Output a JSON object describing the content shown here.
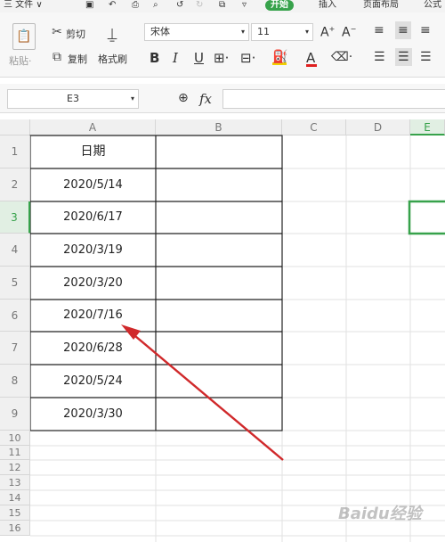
{
  "menubar": {
    "file_label": "三 文件 ∨",
    "tabs": [
      "开始",
      "插入",
      "页面布局",
      "公式"
    ]
  },
  "ribbon": {
    "paste_label": "粘贴·",
    "cut_label": "剪切",
    "copy_label": "复制",
    "format_painter_label": "格式刷",
    "font_name": "宋体",
    "font_size": "11",
    "bold": "B",
    "italic": "I",
    "underline": "U"
  },
  "formula_bar": {
    "name_box": "E3",
    "fx": "fx",
    "formula": ""
  },
  "sheet": {
    "columns": [
      "A",
      "B",
      "C",
      "D",
      "E"
    ],
    "header_cell": "日期",
    "dates": [
      "2020/5/14",
      "2020/6/17",
      "2020/3/19",
      "2020/3/20",
      "2020/7/16",
      "2020/6/28",
      "2020/5/24",
      "2020/3/30"
    ],
    "row_numbers": [
      "1",
      "2",
      "3",
      "4",
      "5",
      "6",
      "7",
      "8",
      "9",
      "10",
      "11",
      "12",
      "13",
      "14",
      "15",
      "16"
    ]
  },
  "watermark": "Baidu经验",
  "colors": {
    "accent": "#37a24b",
    "arrow": "#d0292b"
  }
}
